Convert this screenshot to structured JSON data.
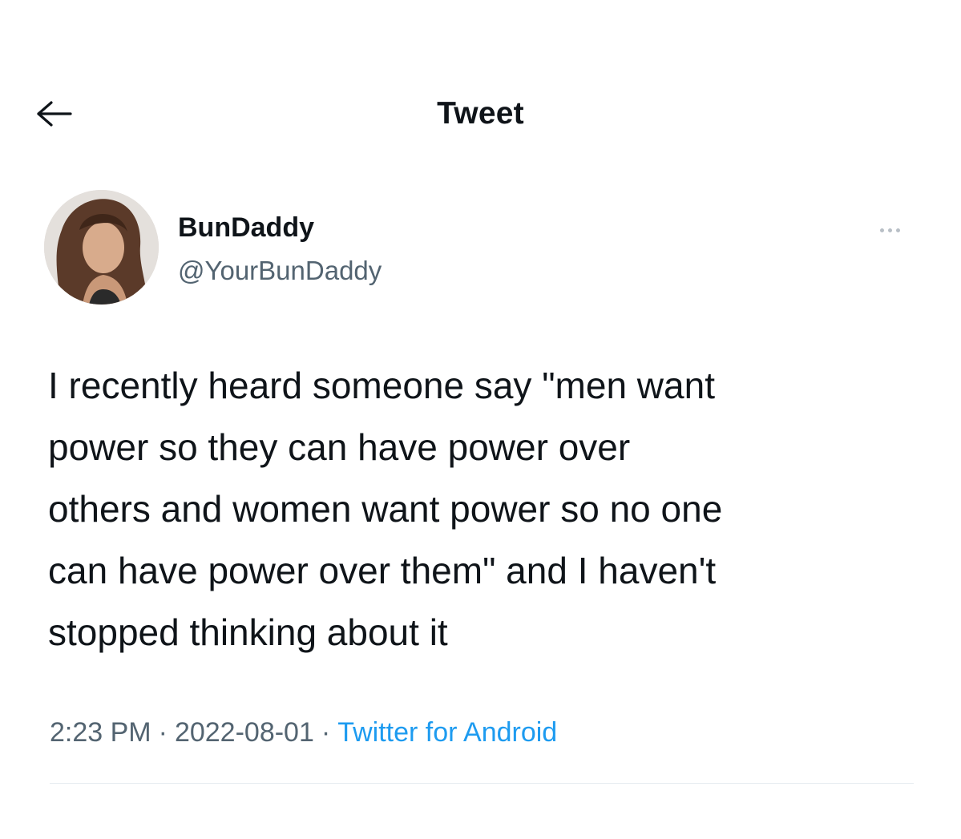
{
  "header": {
    "title": "Tweet",
    "back_icon": "arrow-left-icon"
  },
  "author": {
    "display_name": "BunDaddy",
    "handle": "@YourBunDaddy",
    "more_icon": "more-horizontal-icon"
  },
  "tweet": {
    "lines": [
      "I recently heard someone say \"men want",
      "power so they can have power over",
      "others and women want power so no one",
      "can have power over them\" and I haven't",
      "stopped thinking about it"
    ]
  },
  "meta": {
    "time": "2:23 PM",
    "separator": "·",
    "date": "2022-08-01",
    "source": "Twitter for Android"
  },
  "colors": {
    "text": "#0f1419",
    "secondary": "#536471",
    "link": "#1d9bf0",
    "divider": "#e6ecf0"
  }
}
